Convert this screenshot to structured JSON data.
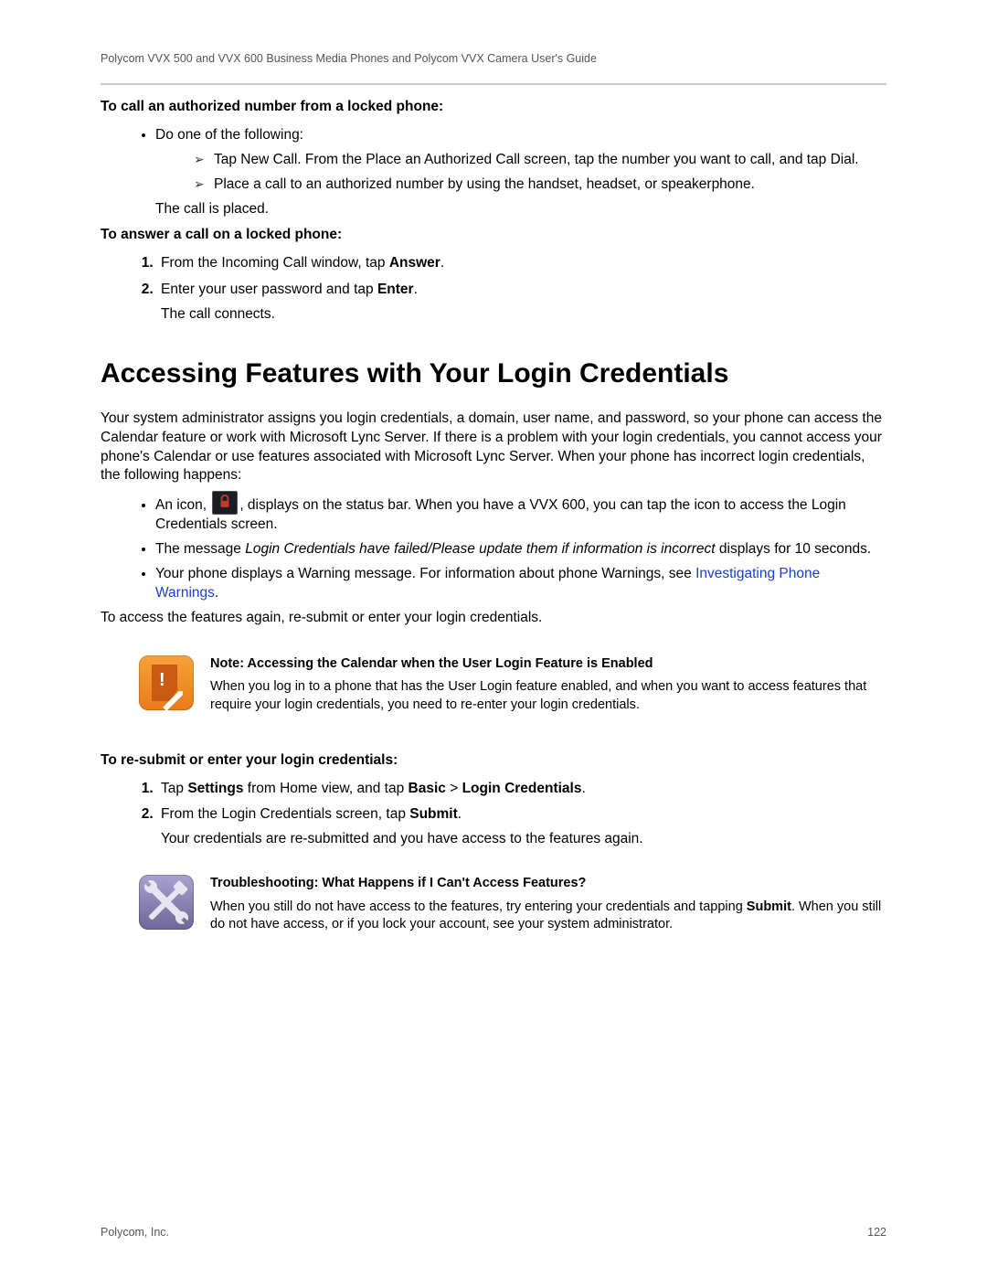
{
  "header": "Polycom VVX 500 and VVX 600 Business Media Phones and Polycom VVX Camera User's Guide",
  "sect1_title": "To call an authorized number from a locked phone:",
  "sect1_intro": "Do one of the following:",
  "sect1_arrow1": "Tap New Call. From the Place an Authorized Call screen, tap the number you want to call, and tap Dial.",
  "sect1_arrow2": "Place a call to an authorized number by using the handset, headset, or speakerphone.",
  "sect1_conclusion": "The call is placed.",
  "sect2_title": "To answer a call on a locked phone:",
  "sect2_step1_pre": "From the Incoming Call window, tap ",
  "sect2_step1_b": "Answer",
  "sect2_step2_pre": "Enter your user password and tap ",
  "sect2_step2_b": "Enter",
  "sect2_conclusion": "The call connects.",
  "h1": "Accessing Features with Your Login Credentials",
  "intro": "Your system administrator assigns you login credentials, a domain, user name, and password, so your phone can access the Calendar feature or work with Microsoft Lync Server. If there is a problem with your login credentials, you cannot access your phone's Calendar or use features associated with Microsoft Lync Server. When your phone has incorrect login credentials, the following happens:",
  "bullet1_pre": "An icon, ",
  "bullet1_post": ", displays on the status bar. When you have a VVX 600, you can tap the icon to access the Login Credentials screen.",
  "bullet2_pre": "The message ",
  "bullet2_i": "Login Credentials have failed/Please update them if information is incorrect",
  "bullet2_post": " displays for 10 seconds.",
  "bullet3_pre": "Your phone displays a Warning message. For information about phone Warnings, see ",
  "bullet3_link": "Investigating Phone Warnings",
  "after_bullets": "To access the features again, re-submit or enter your login credentials.",
  "note_title": "Note: Accessing the Calendar when the User Login Feature is Enabled",
  "note_body": "When you log in to a phone that has the User Login feature enabled, and when you want to access features that require your login credentials, you need to re-enter your login credentials.",
  "sect3_title": "To re-submit or enter your login credentials:",
  "sect3_s1_a": "Tap ",
  "sect3_s1_b1": "Settings",
  "sect3_s1_c": " from Home view, and tap ",
  "sect3_s1_b2": "Basic",
  "sect3_s1_d": " > ",
  "sect3_s1_b3": "Login Credentials",
  "sect3_s2_a": "From the Login Credentials screen, tap ",
  "sect3_s2_b": "Submit",
  "sect3_conclusion": "Your credentials are re-submitted and you have access to the features again.",
  "trouble_title": "Troubleshooting: What Happens if I Can't Access Features?",
  "trouble_a": "When you still do not have access to the features, try entering your credentials and tapping ",
  "trouble_b": "Submit",
  "trouble_c": ". When you still do not have access, or if you lock your account, see your system administrator.",
  "footer_left": "Polycom, Inc.",
  "footer_right": "122"
}
